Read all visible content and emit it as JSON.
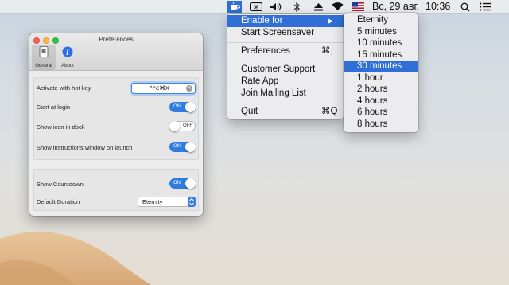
{
  "menubar": {
    "battery_icon": "battery-icon",
    "date_time": "Вс, 29 авг.",
    "clock": "10:36",
    "icons": [
      "caffeine-cup-icon",
      "keyboard-shortcut-icon",
      "volume-icon",
      "bluetooth-icon",
      "eject-icon",
      "wifi-icon",
      "us-flag-icon",
      "search-icon",
      "list-icon"
    ]
  },
  "main_menu": {
    "items": [
      {
        "label": "Enable for",
        "submenu_arrow": "▶",
        "highlighted": true
      },
      {
        "label": "Start Screensaver"
      },
      {
        "label": "Preferences",
        "shortcut": "⌘,"
      },
      {
        "label": "Customer Support"
      },
      {
        "label": "Rate App"
      },
      {
        "label": "Join Mailing List"
      },
      {
        "label": "Quit",
        "shortcut": "⌘Q"
      }
    ]
  },
  "submenu": {
    "items": [
      "Eternity",
      "5 minutes",
      "10 minutes",
      "15 minutes",
      "30 minutes",
      "1 hour",
      "2 hours",
      "4 hours",
      "6 hours",
      "8 hours"
    ],
    "selected": "30 minutes"
  },
  "window": {
    "title": "Preferences",
    "toolbar": {
      "general_label": "General",
      "about_label": "About"
    },
    "settings": {
      "hotkey_label": "Activate with hot key",
      "hotkey_value": "^⌥⌘X",
      "start_login_label": "Start at login",
      "start_login_state": "ON",
      "show_icon_label": "Show icon in dock",
      "show_icon_state": "OFF",
      "show_instructions_label": "Show instructions window on launch",
      "show_instructions_state": "ON",
      "countdown_label": "Show Countdown",
      "countdown_state": "ON",
      "duration_label": "Default Duration",
      "duration_value": "Eternity"
    }
  },
  "colors": {
    "accent": "#2f6fd6",
    "toggle_on": "#2f7de0",
    "desert": "#e0b98a"
  }
}
